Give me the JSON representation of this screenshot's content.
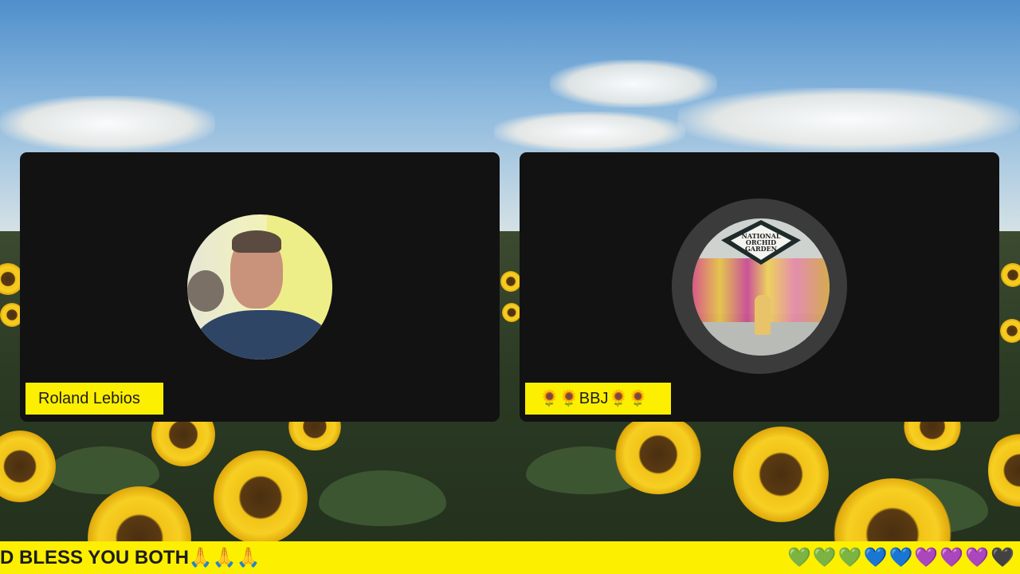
{
  "participants": [
    {
      "name": "Roland Lebios",
      "avatar": "user-photo-man"
    },
    {
      "name": "🌻🌻BBJ🌻🌻",
      "avatar": "user-photo-garden",
      "avatar_sign": "NATIONAL ORCHID GARDEN"
    }
  ],
  "ticker": {
    "text": "D BLESS YOU BOTH🙏🙏🙏",
    "hearts": "💚💚💚💙💙💜💜💜🖤"
  },
  "background": "sunflower-field"
}
